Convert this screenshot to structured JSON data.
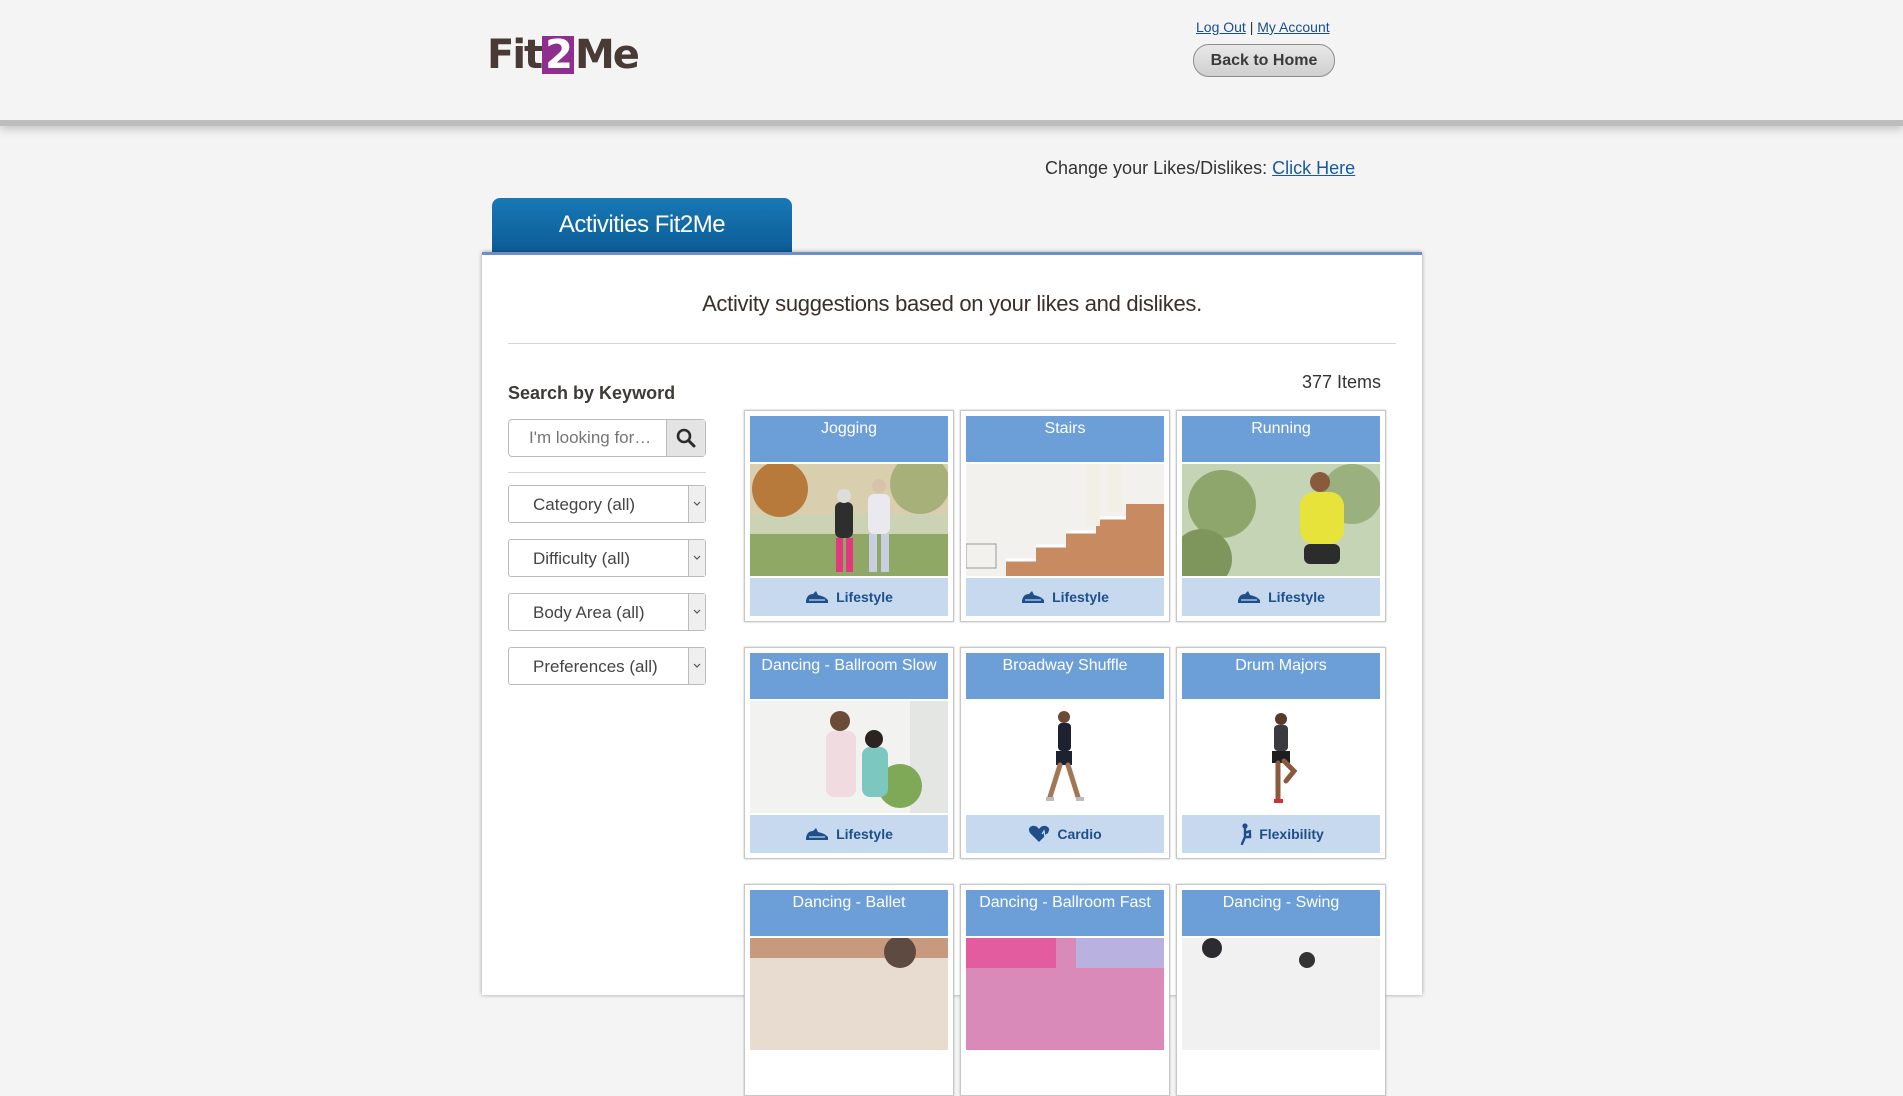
{
  "header": {
    "logo_text_before": "Fit",
    "logo_text_number": "2",
    "logo_text_after": "Me",
    "logout_label": "Log Out",
    "separator": "|",
    "account_label": "My Account",
    "home_button": "Back to Home"
  },
  "likes": {
    "prompt": "Change your Likes/Dislikes:",
    "link": "Click Here"
  },
  "tab": {
    "label": "Activities Fit2Me"
  },
  "panel": {
    "title": "Activity suggestions based on your likes and dislikes.",
    "items_count": "377 Items"
  },
  "sidebar": {
    "search_label": "Search by Keyword",
    "search_placeholder": "I'm looking for…",
    "filters": [
      {
        "label": "Category (all)"
      },
      {
        "label": "Difficulty (all)"
      },
      {
        "label": "Body Area (all)"
      },
      {
        "label": "Preferences (all)"
      }
    ]
  },
  "colors": {
    "accent_blue": "#0b5c95",
    "card_title": "#6c9fd8",
    "card_category": "#c6d9ef",
    "logo_purple": "#8e2f8f"
  },
  "activities": [
    {
      "title": "Jogging",
      "category": "Lifestyle",
      "icon": "shoe-icon"
    },
    {
      "title": "Stairs",
      "category": "Lifestyle",
      "icon": "shoe-icon"
    },
    {
      "title": "Running",
      "category": "Lifestyle",
      "icon": "shoe-icon"
    },
    {
      "title": "Dancing - Ballroom Slow",
      "category": "Lifestyle",
      "icon": "shoe-icon"
    },
    {
      "title": "Broadway Shuffle",
      "category": "Cardio",
      "icon": "heart-icon"
    },
    {
      "title": "Drum Majors",
      "category": "Flexibility",
      "icon": "stretch-figure-icon"
    },
    {
      "title": "Dancing - Ballet",
      "category": "",
      "icon": ""
    },
    {
      "title": "Dancing - Ballroom Fast",
      "category": "",
      "icon": ""
    },
    {
      "title": "Dancing - Swing",
      "category": "",
      "icon": ""
    }
  ]
}
